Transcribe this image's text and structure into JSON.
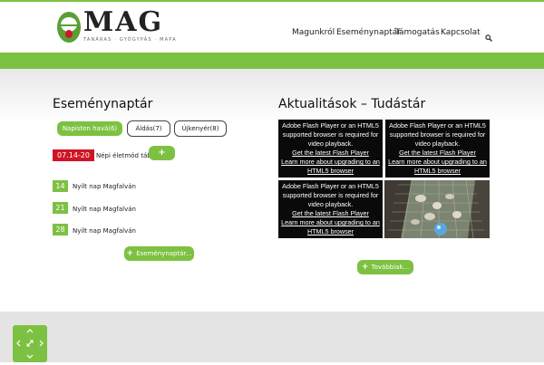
{
  "header": {
    "logo_text": "MAG",
    "logo_sub": "TANÁRAS · GYÓGYPÁS · MAPA",
    "nav": [
      "Magunkról",
      "Eseménynaptár",
      "Támogatás",
      "Kapcsolat"
    ]
  },
  "events": {
    "title": "Eseménynaptár",
    "tabs": [
      "Napisten havá(6)",
      "Áldás(7)",
      "Újkenyér(8)"
    ],
    "featured": {
      "date": "07.14-20",
      "label": "Népi életmód tábor"
    },
    "items": [
      {
        "day": "14",
        "label": "Nyílt nap Magfalván"
      },
      {
        "day": "21",
        "label": "Nyílt nap Magfalván"
      },
      {
        "day": "28",
        "label": "Nyílt nap Magfalván"
      }
    ],
    "more_label": "Eseménynaptár..."
  },
  "news": {
    "title": "Aktualitások – Tudástár",
    "video_msg_1": "Adobe Flash Player or an HTML5",
    "video_msg_2": "supported browser is required for",
    "video_msg_3": "video playback.",
    "video_link_1": "Get the latest Flash Player",
    "video_link_2": "Learn more about upgrading to an",
    "video_link_3": "HTML5 browser",
    "more_label": "Továbbiak..."
  },
  "icons": {
    "search": "search-icon",
    "plus": "plus-icon",
    "arrows": "move-arrows-icon"
  },
  "colors": {
    "accent": "#7dc142",
    "date_red": "#cf1525"
  }
}
